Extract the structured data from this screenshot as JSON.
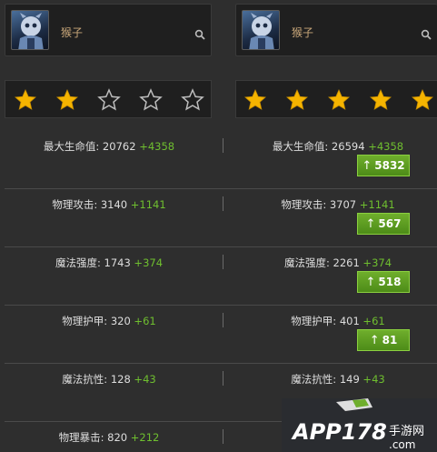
{
  "heroes": [
    {
      "name": "猴子",
      "stars_filled": 2,
      "stars_total": 5
    },
    {
      "name": "猴子",
      "stars_filled": 5,
      "stars_total": 5
    }
  ],
  "stats": [
    {
      "left_label": "最大生命值: 20762",
      "left_bonus": "+4358",
      "right_label": "最大生命值: 26594",
      "right_bonus": "+4358",
      "diff": "5832"
    },
    {
      "left_label": "物理攻击: 3140",
      "left_bonus": "+1141",
      "right_label": "物理攻击: 3707",
      "right_bonus": "+1141",
      "diff": "567"
    },
    {
      "left_label": "魔法强度: 1743",
      "left_bonus": "+374",
      "right_label": "魔法强度: 2261",
      "right_bonus": "+374",
      "diff": "518"
    },
    {
      "left_label": "物理护甲: 320",
      "left_bonus": "+61",
      "right_label": "物理护甲: 401",
      "right_bonus": "+61",
      "diff": "81"
    },
    {
      "left_label": "魔法抗性: 128",
      "left_bonus": "+43",
      "right_label": "魔法抗性: 149",
      "right_bonus": "+43",
      "diff": ""
    },
    {
      "left_label": "物理暴击: 820",
      "left_bonus": "+212",
      "right_label": "",
      "right_bonus": "",
      "diff": ""
    }
  ],
  "arrow_glyph": "↑",
  "watermark": {
    "brand": "APP178",
    "suffix": "手游网",
    "domain": ".com"
  },
  "colors": {
    "star_fill": "#f5b400",
    "bonus": "#6fbf2f",
    "badge": "#5c9e22",
    "name": "#c9a77a"
  }
}
